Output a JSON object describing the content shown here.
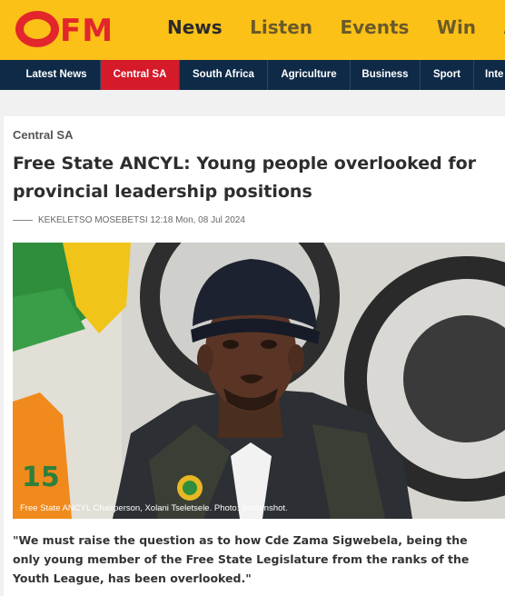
{
  "brand": {
    "logo_text": "OFM",
    "accent": "#fbc117",
    "red": "#d51a2a",
    "navy": "#0e2a47"
  },
  "main_nav": [
    "News",
    "Listen",
    "Events",
    "Win",
    "Ad"
  ],
  "sub_nav": [
    "Latest News",
    "Central SA",
    "South Africa",
    "Agriculture",
    "Business",
    "Sport",
    "Inte"
  ],
  "sub_nav_active": "Central SA",
  "article": {
    "category": "Central SA",
    "title": "Free State ANCYL: Young people overlooked for provincial leadership positions",
    "byline": "KEKELETSO MOSEBETSI 12:18 Mon, 08 Jul 2024",
    "image_caption": "Free State ANCYL Chairperson, Xolani Tseletsele. Photo: Screenshot.",
    "quote": "\"We must raise the question as to how Cde Zama Sigwebela, being the only young member of the Free State Legislature from the ranks of the Youth League, has been overlooked.\""
  }
}
